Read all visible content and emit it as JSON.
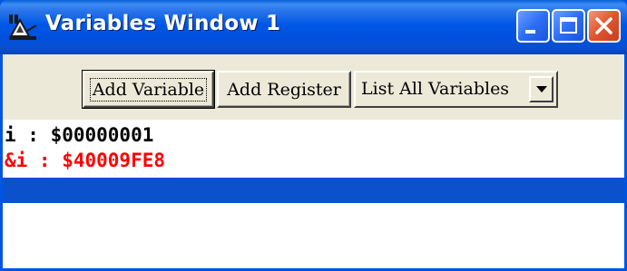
{
  "window": {
    "title": "Variables Window 1"
  },
  "toolbar": {
    "add_variable_label": "Add Variable",
    "add_register_label": "Add Register",
    "list_select_value": "List All Variables"
  },
  "variables": [
    {
      "text": "i : $00000001",
      "color": "#000000"
    },
    {
      "text": "&i : $40009FE8",
      "color": "#ff0000"
    }
  ],
  "colors": {
    "title_bar": "#0058e6",
    "selection": "#0a51cb",
    "highlight_text": "#ff0000",
    "close_button": "#e0552f"
  }
}
